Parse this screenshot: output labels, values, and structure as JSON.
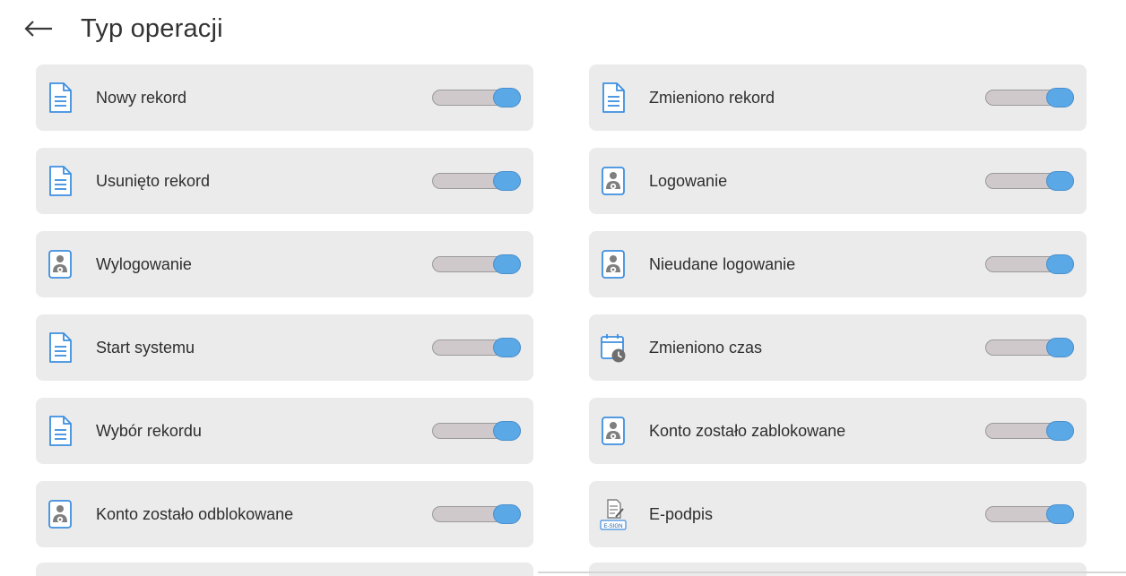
{
  "header": {
    "title": "Typ operacji",
    "back_icon": "arrow-left-icon"
  },
  "colors": {
    "row_background": "#ebebeb",
    "toggle_track": "#cfc9cc",
    "toggle_knob": "#5aa8e6",
    "icon_blue": "#3d8fe0",
    "icon_gray": "#7f7f7f"
  },
  "items": [
    {
      "label": "Nowy rekord",
      "icon": "document-icon",
      "enabled": true
    },
    {
      "label": "Zmieniono rekord",
      "icon": "document-icon",
      "enabled": true
    },
    {
      "label": "Usunięto rekord",
      "icon": "document-icon",
      "enabled": true
    },
    {
      "label": "Logowanie",
      "icon": "user-settings-icon",
      "enabled": true
    },
    {
      "label": "Wylogowanie",
      "icon": "user-settings-icon",
      "enabled": true
    },
    {
      "label": "Nieudane logowanie",
      "icon": "user-settings-icon",
      "enabled": true
    },
    {
      "label": "Start systemu",
      "icon": "document-icon",
      "enabled": true
    },
    {
      "label": "Zmieniono czas",
      "icon": "calendar-clock-icon",
      "enabled": true
    },
    {
      "label": "Wybór rekordu",
      "icon": "document-icon",
      "enabled": true
    },
    {
      "label": "Konto zostało zablokowane",
      "icon": "user-settings-icon",
      "enabled": true
    },
    {
      "label": "Konto zostało odblokowane",
      "icon": "user-settings-icon",
      "enabled": true
    },
    {
      "label": "E-podpis",
      "icon": "e-sign-icon",
      "enabled": true,
      "icon_text": "E-SIGN"
    }
  ]
}
